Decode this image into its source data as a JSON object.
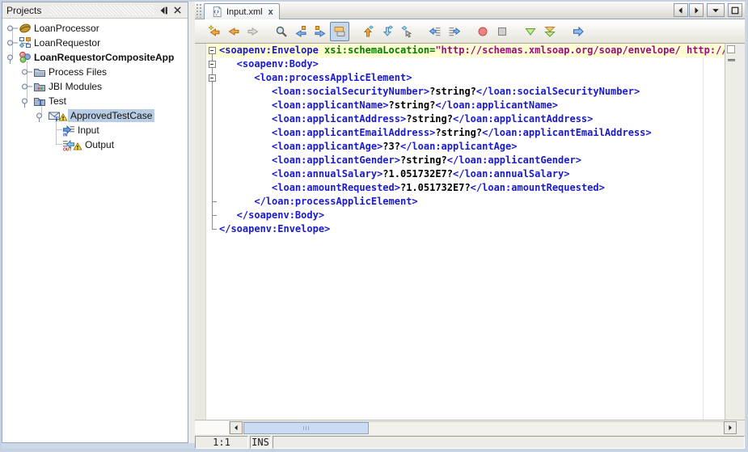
{
  "sidebar": {
    "title": "Projects",
    "tree": [
      {
        "label": "LoanProcessor",
        "icon": "bpel-project-icon",
        "level": 0,
        "handle": "collapsed"
      },
      {
        "label": "LoanRequestor",
        "icon": "composite-project-icon",
        "level": 0,
        "handle": "collapsed"
      },
      {
        "label": "LoanRequestorCompositeApp",
        "icon": "composite-app-project-icon",
        "level": 0,
        "handle": "expanded",
        "bold": true
      },
      {
        "label": "Process Files",
        "icon": "folder-icon",
        "level": 1,
        "handle": "collapsed"
      },
      {
        "label": "JBI Modules",
        "icon": "jbi-modules-folder-icon",
        "level": 1,
        "handle": "collapsed"
      },
      {
        "label": "Test",
        "icon": "test-folder-icon",
        "level": 1,
        "handle": "expanded"
      },
      {
        "label": "ApprovedTestCase",
        "icon": "testcase-icon",
        "level": 2,
        "handle": "expanded",
        "selected": true,
        "warning": true
      },
      {
        "label": "Input",
        "icon": "input-icon",
        "level": 3,
        "handle": "none"
      },
      {
        "label": "Output",
        "icon": "output-icon",
        "level": 3,
        "handle": "none",
        "warning": true
      }
    ]
  },
  "editor": {
    "tab": {
      "label": "Input.xml",
      "close_glyph": "x"
    },
    "toolbar": [
      {
        "name": "jump-to-last-edit-button",
        "icon": "jump-last-edit-icon"
      },
      {
        "name": "navigate-back-button",
        "icon": "nav-back-icon"
      },
      {
        "name": "navigate-forward-button",
        "icon": "nav-forward-icon",
        "disabled": true
      },
      {
        "sep": true
      },
      {
        "name": "find-button",
        "icon": "find-icon"
      },
      {
        "name": "previous-occurrence-button",
        "icon": "prev-occurrence-icon"
      },
      {
        "name": "next-occurrence-button",
        "icon": "next-occurrence-icon"
      },
      {
        "name": "toggle-highlight-button",
        "icon": "toggle-highlight-icon",
        "pressed": true
      },
      {
        "sep": true
      },
      {
        "name": "move-up-button",
        "icon": "move-up-icon"
      },
      {
        "name": "move-down-button",
        "icon": "move-down-icon"
      },
      {
        "name": "select-element-button",
        "icon": "select-element-icon"
      },
      {
        "sep": true
      },
      {
        "name": "shift-left-button",
        "icon": "shift-left-icon"
      },
      {
        "name": "shift-right-button",
        "icon": "shift-right-icon"
      },
      {
        "sep": true
      },
      {
        "name": "record-macro-button",
        "icon": "record-macro-icon"
      },
      {
        "name": "stop-macro-button",
        "icon": "stop-macro-icon"
      },
      {
        "sep": true
      },
      {
        "name": "validate-xml-button",
        "icon": "validate-xml-icon"
      },
      {
        "name": "check-xml-button",
        "icon": "check-xml-icon"
      },
      {
        "sep": true
      },
      {
        "name": "run-button",
        "icon": "run-icon"
      }
    ],
    "lines": [
      {
        "fold": "box-first",
        "highlight": true,
        "tokens": [
          [
            "tag",
            "<soapenv:Envelope"
          ],
          [
            "attr",
            " xsi:schemaLocation="
          ],
          [
            "value",
            "\"http://schemas.xmlsoap.org/soap/envelope/ http://sch"
          ]
        ]
      },
      {
        "fold": "box",
        "tokens": [
          [
            "tag",
            "   <soapenv:Body>"
          ]
        ]
      },
      {
        "fold": "box",
        "tokens": [
          [
            "tag",
            "      <loan:processApplicElement>"
          ]
        ]
      },
      {
        "fold": "line",
        "tokens": [
          [
            "tag",
            "         <loan:socialSecurityNumber>"
          ],
          [
            "text",
            "?string?"
          ],
          [
            "tag",
            "</loan:socialSecurityNumber>"
          ]
        ]
      },
      {
        "fold": "line",
        "tokens": [
          [
            "tag",
            "         <loan:applicantName>"
          ],
          [
            "text",
            "?string?"
          ],
          [
            "tag",
            "</loan:applicantName>"
          ]
        ]
      },
      {
        "fold": "line",
        "tokens": [
          [
            "tag",
            "         <loan:applicantAddress>"
          ],
          [
            "text",
            "?string?"
          ],
          [
            "tag",
            "</loan:applicantAddress>"
          ]
        ]
      },
      {
        "fold": "line",
        "tokens": [
          [
            "tag",
            "         <loan:applicantEmailAddress>"
          ],
          [
            "text",
            "?string?"
          ],
          [
            "tag",
            "</loan:applicantEmailAddress>"
          ]
        ]
      },
      {
        "fold": "line",
        "tokens": [
          [
            "tag",
            "         <loan:applicantAge>"
          ],
          [
            "text",
            "?3?"
          ],
          [
            "tag",
            "</loan:applicantAge>"
          ]
        ]
      },
      {
        "fold": "line",
        "tokens": [
          [
            "tag",
            "         <loan:applicantGender>"
          ],
          [
            "text",
            "?string?"
          ],
          [
            "tag",
            "</loan:applicantGender>"
          ]
        ]
      },
      {
        "fold": "line",
        "tokens": [
          [
            "tag",
            "         <loan:annualSalary>"
          ],
          [
            "text",
            "?1.051732E7?"
          ],
          [
            "tag",
            "</loan:annualSalary>"
          ]
        ]
      },
      {
        "fold": "line",
        "tokens": [
          [
            "tag",
            "         <loan:amountRequested>"
          ],
          [
            "text",
            "?1.051732E7?"
          ],
          [
            "tag",
            "</loan:amountRequested>"
          ]
        ]
      },
      {
        "fold": "tick",
        "tokens": [
          [
            "tag",
            "      </loan:processApplicElement>"
          ]
        ]
      },
      {
        "fold": "tick",
        "tokens": [
          [
            "tag",
            "   </soapenv:Body>"
          ]
        ]
      },
      {
        "fold": "end",
        "tokens": [
          [
            "tag",
            "</soapenv:Envelope>"
          ]
        ]
      }
    ]
  },
  "statusbar": {
    "caret_position": "1:1",
    "typing_mode": "INS"
  }
}
